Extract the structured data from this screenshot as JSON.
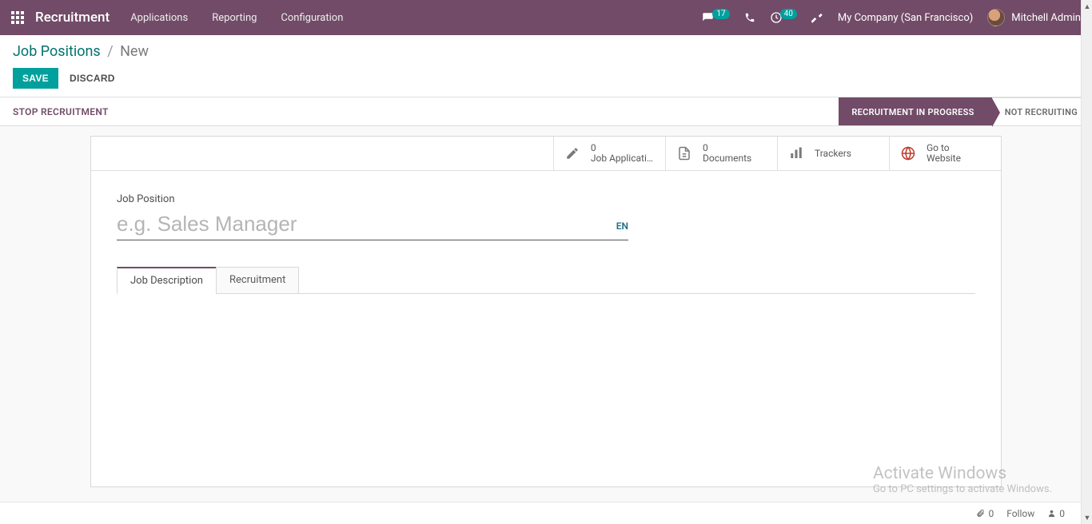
{
  "topbar": {
    "brand": "Recruitment",
    "nav": [
      "Applications",
      "Reporting",
      "Configuration"
    ],
    "chat_badge": "17",
    "activity_badge": "40",
    "company": "My Company (San Francisco)",
    "user": "Mitchell Admin"
  },
  "breadcrumb": {
    "root": "Job Positions",
    "current": "New"
  },
  "actions": {
    "save": "SAVE",
    "discard": "DISCARD"
  },
  "statusbar": {
    "stop": "STOP RECRUITMENT",
    "stages": [
      {
        "label": "RECRUITMENT IN PROGRESS",
        "active": true
      },
      {
        "label": "NOT RECRUITING",
        "active": false
      }
    ]
  },
  "stats": {
    "applications": {
      "count": "0",
      "label": "Job Applicati..."
    },
    "documents": {
      "count": "0",
      "label": "Documents"
    },
    "trackers": {
      "label": "Trackers"
    },
    "website": {
      "line1": "Go to",
      "line2": "Website"
    }
  },
  "form": {
    "field_label": "Job Position",
    "placeholder": "e.g. Sales Manager",
    "value": "",
    "lang": "EN"
  },
  "tabs": {
    "items": [
      "Job Description",
      "Recruitment"
    ],
    "active": 0
  },
  "chatter": {
    "attachments": "0",
    "follow": "Follow",
    "followers": "0"
  },
  "watermark": {
    "line1": "Activate Windows",
    "line2": "Go to PC settings to activate Windows."
  }
}
